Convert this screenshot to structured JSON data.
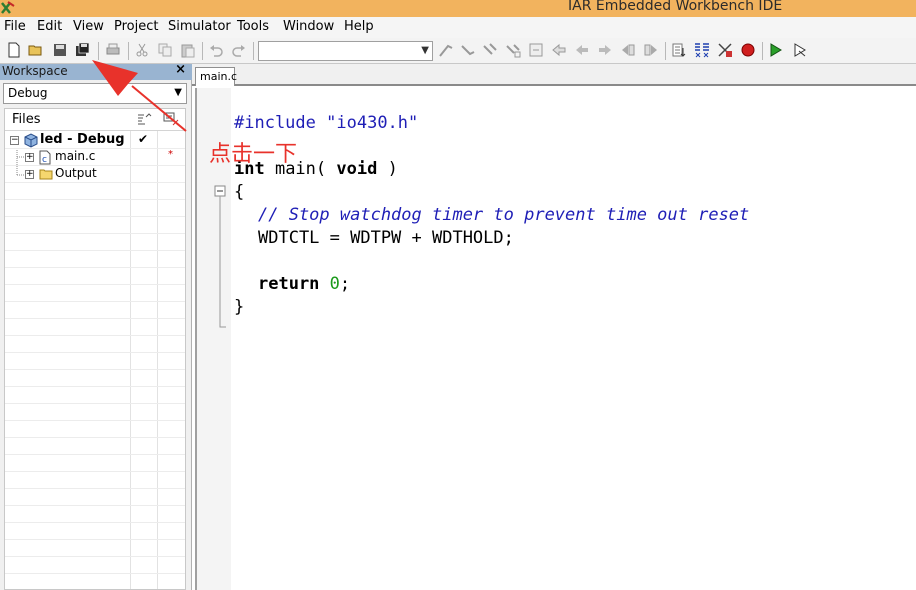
{
  "window": {
    "title": "IAR Embedded Workbench IDE"
  },
  "menu": [
    "File",
    "Edit",
    "View",
    "Project",
    "Simulator",
    "Tools",
    "Window",
    "Help"
  ],
  "toolbar": {
    "config_combo_value": "",
    "icons": [
      "new-file-icon",
      "open-file-icon",
      "save-icon",
      "save-all-icon",
      "print-icon",
      "cut-icon",
      "copy-icon",
      "paste-icon",
      "undo-icon",
      "redo-icon"
    ]
  },
  "workspace": {
    "title": "Workspace",
    "close": "×",
    "configuration": "Debug",
    "columns": {
      "files": "Files"
    },
    "tree": [
      {
        "label": "led - Debug",
        "check": "✔",
        "level": 0
      },
      {
        "label": "main.c",
        "flag": "*",
        "level": 1
      },
      {
        "label": "Output",
        "level": 1
      }
    ]
  },
  "editor": {
    "tab": "main.c",
    "lines": {
      "include_directive": "#include",
      "include_file": "\"io430.h\"",
      "int_kw": "int",
      "main_sig": " main( ",
      "void_kw": "void",
      "main_close": " )",
      "open_brace": "{",
      "comment": "// Stop watchdog timer to prevent time out reset",
      "wdt_stmt": "WDTCTL = WDTPW + WDTHOLD;",
      "return_kw": "return",
      "return_val": "0",
      "return_end": ";",
      "close_brace": "}"
    }
  },
  "annotation": {
    "text": "点击一下",
    "color": "#e8322b"
  }
}
